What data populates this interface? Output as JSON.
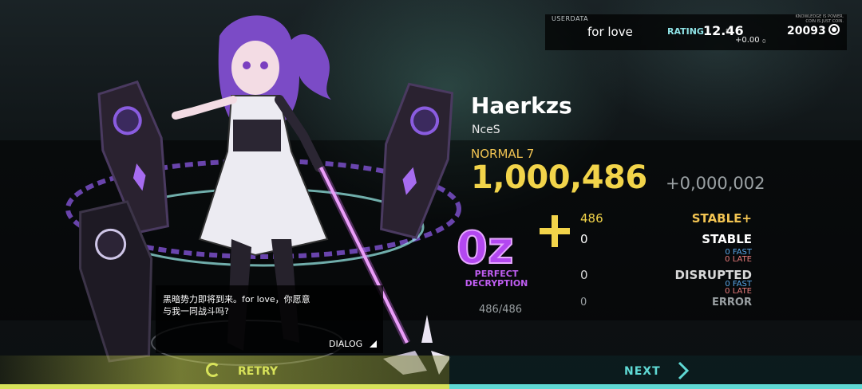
{
  "userdata": {
    "label": "USERDATA",
    "name": "for love",
    "rating_label": "RATING",
    "rating": "12.46",
    "rating_sub": "8",
    "rating_delta": "+0.00",
    "rating_delta_sub": "0",
    "motto_line1": "KNOWLEDGE IS POWER.",
    "motto_line2": "COIN IS JUST COIN.",
    "coins": "20093"
  },
  "song": {
    "title": "Haerkzs",
    "artist": "NceS",
    "difficulty": "NORMAL 7"
  },
  "result": {
    "score": "1,000,486",
    "score_diff": "+0,000,002",
    "rank": "0z",
    "rank_label_line1": "PERFECT",
    "rank_label_line2": "DECRYPTION",
    "stable_plus_count": "486",
    "stable_plus_label": "STABLE+",
    "stable_count": "0",
    "stable_label": "STABLE",
    "stable_fast": "0 FAST",
    "stable_late": "0 LATE",
    "disrupted_count": "0",
    "disrupted_label": "DISRUPTED",
    "disrupted_fast": "0 FAST",
    "disrupted_late": "0 LATE",
    "error_count": "0",
    "error_label": "ERROR",
    "total": "486/486"
  },
  "dialog": {
    "text": "黑暗势力即将到来。for love，你愿意与我一同战斗吗?",
    "button": "DIALOG"
  },
  "bottom": {
    "retry": "RETRY",
    "next": "NEXT"
  },
  "colors": {
    "score_gold": "#f2d44a",
    "rank_purple": "#c05ef2",
    "retry_lime": "#d7e25a",
    "next_cyan": "#5fd9d4",
    "fast_blue": "#59a7e8",
    "late_red": "#e87a7a"
  }
}
